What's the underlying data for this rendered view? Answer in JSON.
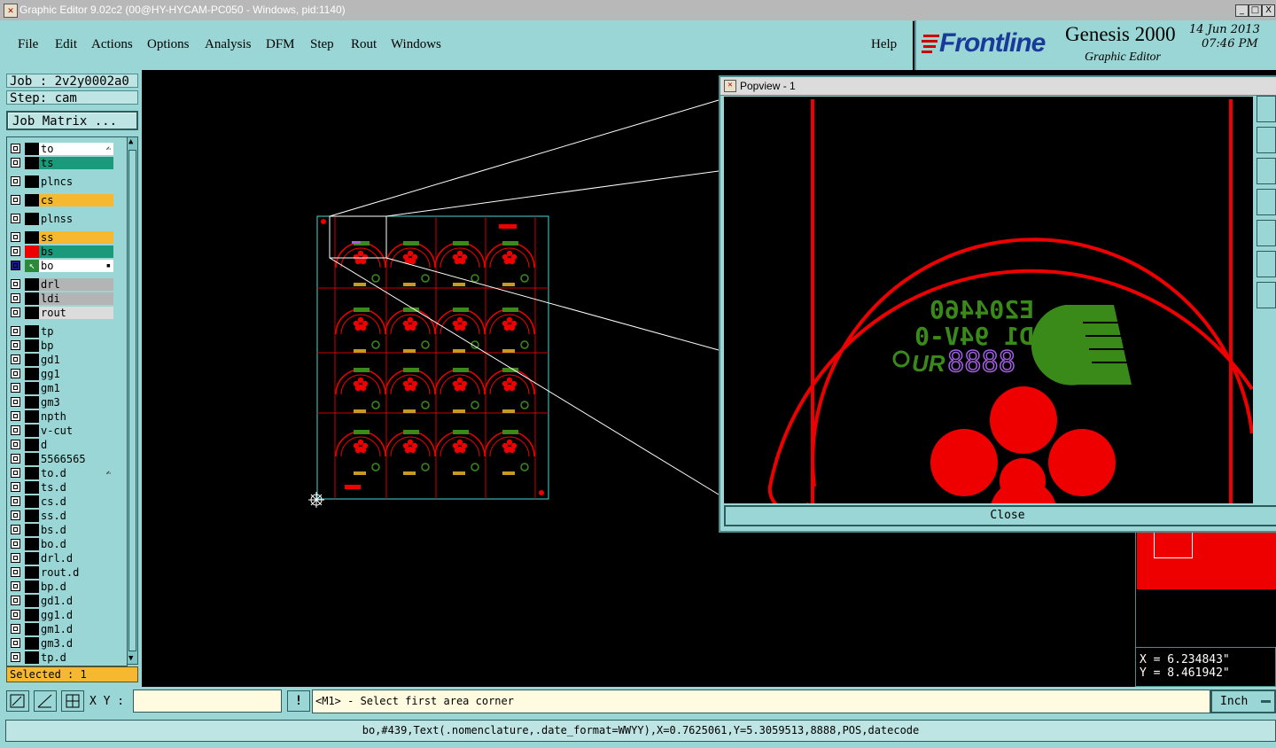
{
  "window": {
    "title": "Graphic Editor 9.02c2 (00@HY-HYCAM-PC050 - Windows, pid:1140)",
    "buttons": [
      "_",
      "□",
      "X"
    ]
  },
  "menu": [
    "File",
    "Edit",
    "Actions",
    "Options",
    "Analysis",
    "DFM",
    "Step",
    "Rout",
    "Windows"
  ],
  "help_label": "Help",
  "brand": {
    "logo": "Frontline",
    "product": "Genesis 2000",
    "subtitle": "Graphic Editor",
    "date": "14 Jun 2013",
    "time": "07:46 PM"
  },
  "job": {
    "job_label": "Job : 2v2y0002a0",
    "step_label": "Step: cam",
    "matrix_button": "Job Matrix ..."
  },
  "layers": [
    {
      "name": "to",
      "color": "#ffffff",
      "mark": "✍"
    },
    {
      "name": "ts",
      "color": "#1a9a7a",
      "mark": ""
    },
    {
      "name": "plncs",
      "color": "#9ad6d6",
      "mark": ""
    },
    {
      "name": "cs",
      "color": "#f5b830",
      "mark": ""
    },
    {
      "name": "plnss",
      "color": "#9ad6d6",
      "mark": ""
    },
    {
      "name": "ss",
      "color": "#f5b830",
      "mark": ""
    },
    {
      "name": "bs",
      "color": "#1a9a7a",
      "mark": ""
    },
    {
      "name": "bo",
      "color": "#ffffff",
      "mark": "▪"
    },
    {
      "name": "drl",
      "color": "#b4b4b4",
      "mark": ""
    },
    {
      "name": "ldi",
      "color": "#b4b4b4",
      "mark": ""
    },
    {
      "name": "rout",
      "color": "#dcdcdc",
      "mark": ""
    },
    {
      "name": "tp",
      "color": "#9ad6d6",
      "mark": ""
    },
    {
      "name": "bp",
      "color": "#9ad6d6",
      "mark": ""
    },
    {
      "name": "gd1",
      "color": "#9ad6d6",
      "mark": ""
    },
    {
      "name": "gg1",
      "color": "#9ad6d6",
      "mark": ""
    },
    {
      "name": "gm1",
      "color": "#9ad6d6",
      "mark": ""
    },
    {
      "name": "gm3",
      "color": "#9ad6d6",
      "mark": ""
    },
    {
      "name": "npth",
      "color": "#9ad6d6",
      "mark": ""
    },
    {
      "name": "v-cut",
      "color": "#9ad6d6",
      "mark": ""
    },
    {
      "name": "d",
      "color": "#9ad6d6",
      "mark": ""
    },
    {
      "name": "5566565",
      "color": "#9ad6d6",
      "mark": ""
    },
    {
      "name": "to.d",
      "color": "#9ad6d6",
      "mark": "✍"
    },
    {
      "name": "ts.d",
      "color": "#9ad6d6",
      "mark": ""
    },
    {
      "name": "cs.d",
      "color": "#9ad6d6",
      "mark": ""
    },
    {
      "name": "ss.d",
      "color": "#9ad6d6",
      "mark": ""
    },
    {
      "name": "bs.d",
      "color": "#9ad6d6",
      "mark": ""
    },
    {
      "name": "bo.d",
      "color": "#9ad6d6",
      "mark": ""
    },
    {
      "name": "drl.d",
      "color": "#9ad6d6",
      "mark": ""
    },
    {
      "name": "rout.d",
      "color": "#9ad6d6",
      "mark": ""
    },
    {
      "name": "bp.d",
      "color": "#9ad6d6",
      "mark": ""
    },
    {
      "name": "gd1.d",
      "color": "#9ad6d6",
      "mark": ""
    },
    {
      "name": "gg1.d",
      "color": "#9ad6d6",
      "mark": ""
    },
    {
      "name": "gm1.d",
      "color": "#9ad6d6",
      "mark": ""
    },
    {
      "name": "gm3.d",
      "color": "#9ad6d6",
      "mark": ""
    },
    {
      "name": "tp.d",
      "color": "#9ad6d6",
      "mark": ""
    }
  ],
  "selected": "Selected : 1",
  "popview": {
    "title": "Popview - 1",
    "close": "Close",
    "markings": {
      "line1": "E204460",
      "line2": "D1 94V-0",
      "line3": "8888",
      "ur": "UR"
    }
  },
  "coords": {
    "x": "X = 6.234843\"",
    "y": "Y = 8.461942\""
  },
  "toolbar": {
    "xy_label": "X Y :",
    "xy_value": "",
    "excl": "!",
    "prompt": "<M1> - Select first area corner",
    "units": "Inch"
  },
  "status": "bo,#439,Text(.nomenclature,.date_format=WWYY),X=0.7625061,Y=5.3059513,8888,POS,datecode"
}
